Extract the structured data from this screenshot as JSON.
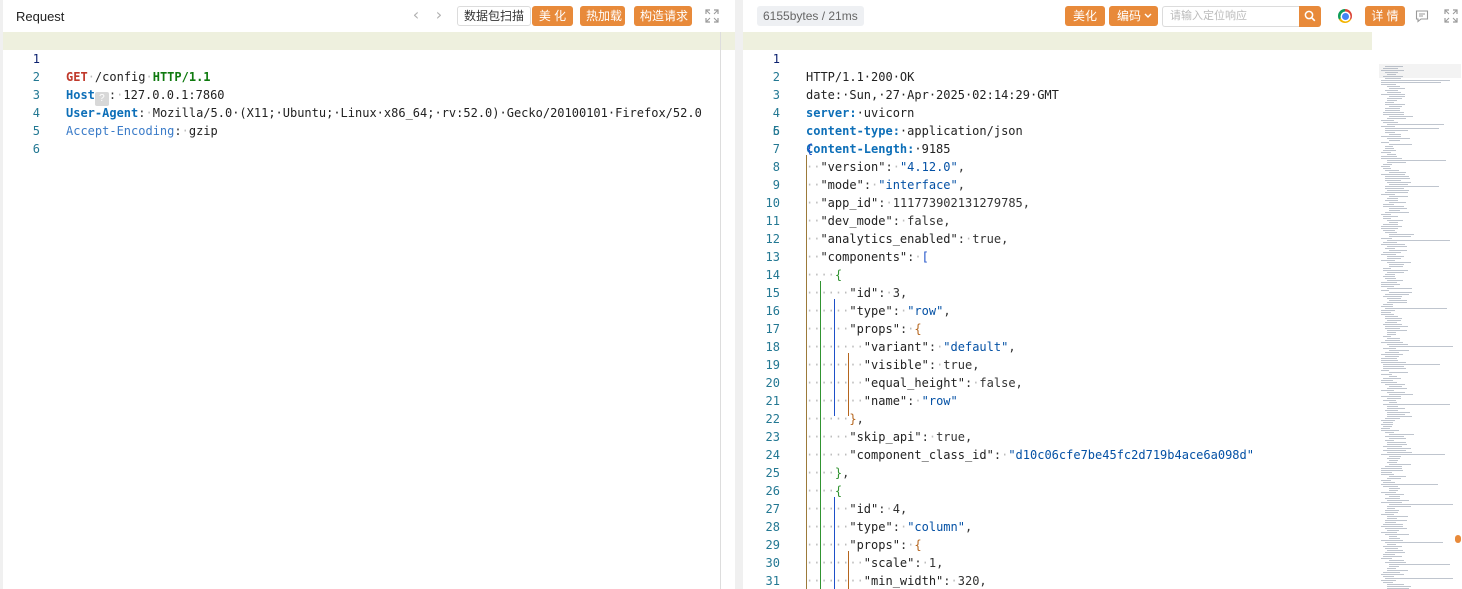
{
  "request": {
    "title": "Request",
    "buttons": {
      "scan": "数据包扫描",
      "beautify": "美 化",
      "hot_load": "热加载",
      "construct": "构造请求"
    },
    "lines": [
      {
        "n": "1",
        "method": "GET",
        "path": "/config",
        "proto": "HTTP/1.1"
      },
      {
        "n": "2",
        "key": "Host",
        "sep": ":",
        "value": "127.0.0.1:7860"
      },
      {
        "n": "3",
        "key": "User-Agent",
        "sep": ":",
        "value": "Mozilla/5.0·(X11;·Ubuntu;·Linux·x86_64;·rv:52.0)·Gecko/20100101·Firefox/52.0"
      },
      {
        "n": "4",
        "key": "Accept-Encoding",
        "sep": ":",
        "value": "gzip"
      },
      {
        "n": "5"
      },
      {
        "n": "6"
      }
    ]
  },
  "response": {
    "stats": "6155bytes / 21ms",
    "buttons": {
      "beautify": "美化",
      "encoding": "编码",
      "details": "详 情"
    },
    "search_placeholder": "请输入定位响应",
    "lines": [
      {
        "n": "1",
        "text": "HTTP/1.1·200·OK"
      },
      {
        "n": "2",
        "text": "date:·Sun,·27·Apr·2025·02:14:29·GMT"
      },
      {
        "n": "3",
        "key": "server:",
        "value": "·uvicorn"
      },
      {
        "n": "4",
        "key": "content-type:",
        "value": "·application/json"
      },
      {
        "n": "5",
        "key": "Content-Length:",
        "value": "·9185"
      },
      {
        "n": "6",
        "text": ""
      },
      {
        "n": "7",
        "text": "{"
      },
      {
        "n": "8",
        "text": "··\"version\":·\"4.12.0\","
      },
      {
        "n": "9",
        "text": "··\"mode\":·\"interface\","
      },
      {
        "n": "10",
        "text": "··\"app_id\":·111773902131279785,"
      },
      {
        "n": "11",
        "text": "··\"dev_mode\":·false,"
      },
      {
        "n": "12",
        "text": "··\"analytics_enabled\":·true,"
      },
      {
        "n": "13",
        "text": "··\"components\":·["
      },
      {
        "n": "14",
        "text": "····{"
      },
      {
        "n": "15",
        "text": "······\"id\":·3,"
      },
      {
        "n": "16",
        "text": "······\"type\":·\"row\","
      },
      {
        "n": "17",
        "text": "······\"props\":·{"
      },
      {
        "n": "18",
        "text": "········\"variant\":·\"default\","
      },
      {
        "n": "19",
        "text": "········\"visible\":·true,"
      },
      {
        "n": "20",
        "text": "········\"equal_height\":·false,"
      },
      {
        "n": "21",
        "text": "········\"name\":·\"row\""
      },
      {
        "n": "22",
        "text": "······},"
      },
      {
        "n": "23",
        "text": "······\"skip_api\":·true,"
      },
      {
        "n": "24",
        "text": "······\"component_class_id\":·\"d10c06cfe7be45fc2d719b4ace6a098d\""
      },
      {
        "n": "25",
        "text": "····},"
      },
      {
        "n": "26",
        "text": "····{"
      },
      {
        "n": "27",
        "text": "······\"id\":·4,"
      },
      {
        "n": "28",
        "text": "······\"type\":·\"column\","
      },
      {
        "n": "29",
        "text": "······\"props\":·{"
      },
      {
        "n": "30",
        "text": "········\"scale\":·1,"
      },
      {
        "n": "31",
        "text": "········\"min_width\":·320,"
      }
    ]
  }
}
